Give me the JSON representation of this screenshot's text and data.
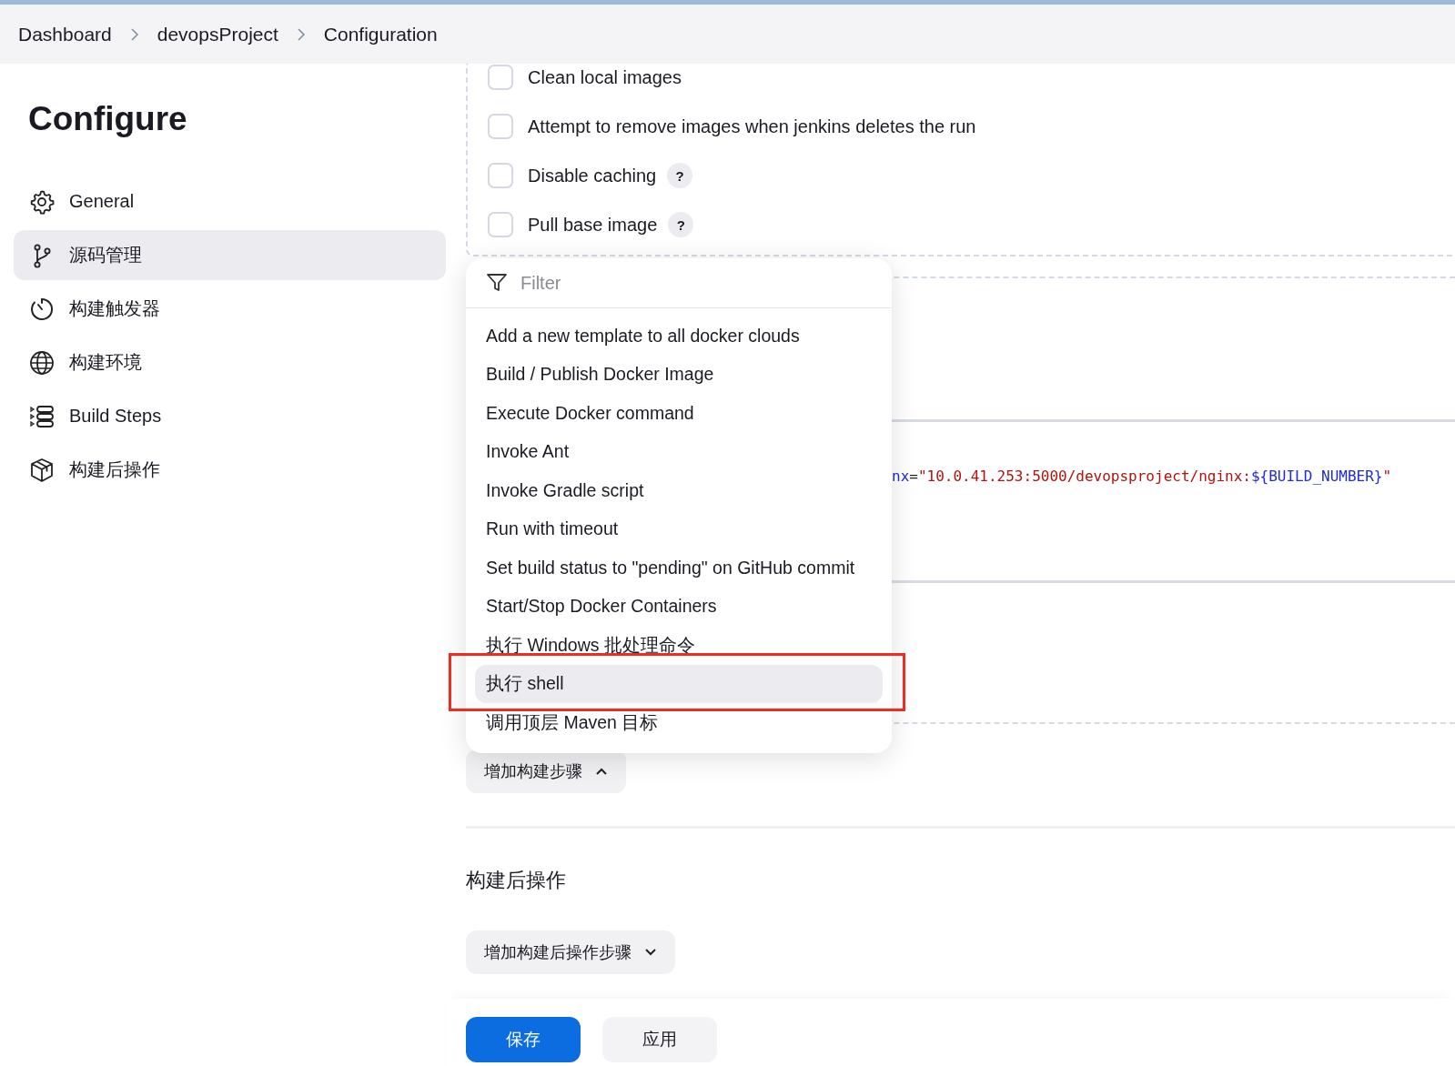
{
  "breadcrumbs": [
    "Dashboard",
    "devopsProject",
    "Configuration"
  ],
  "sidebar": {
    "title": "Configure",
    "items": [
      {
        "kind": "gear",
        "label": "General",
        "selected": false
      },
      {
        "kind": "branch",
        "label": "源码管理",
        "selected": true
      },
      {
        "kind": "timer",
        "label": "构建触发器",
        "selected": false
      },
      {
        "kind": "globe",
        "label": "构建环境",
        "selected": false
      },
      {
        "kind": "steps",
        "label": "Build Steps",
        "selected": false
      },
      {
        "kind": "package",
        "label": "构建后操作",
        "selected": false
      }
    ]
  },
  "options": [
    {
      "label": "Clean local images",
      "checked": false
    },
    {
      "label": "Attempt to remove images when jenkins deletes the run",
      "checked": false
    },
    {
      "label": "Disable caching",
      "checked": false,
      "help": "?"
    },
    {
      "label": "Pull base image",
      "checked": false,
      "help": "?"
    }
  ],
  "code_line": [
    {
      "kind": "name",
      "text": "nx"
    },
    {
      "kind": "op",
      "text": "="
    },
    {
      "kind": "string",
      "text": "\"10.0.41.253:5000/devopsproject/nginx:"
    },
    {
      "kind": "var",
      "text": "${BUILD_NUMBER}"
    },
    {
      "kind": "string",
      "text": "\""
    }
  ],
  "step_menu": {
    "filter_placeholder": "Filter",
    "items": [
      {
        "label": "Add a new template to all docker clouds",
        "selected": false,
        "annotated": false
      },
      {
        "label": "Build / Publish Docker Image",
        "selected": false,
        "annotated": false
      },
      {
        "label": "Execute Docker command",
        "selected": false,
        "annotated": false
      },
      {
        "label": "Invoke Ant",
        "selected": false,
        "annotated": false
      },
      {
        "label": "Invoke Gradle script",
        "selected": false,
        "annotated": false
      },
      {
        "label": "Run with timeout",
        "selected": false,
        "annotated": false
      },
      {
        "label": "Set build status to \"pending\" on GitHub commit",
        "selected": false,
        "annotated": false
      },
      {
        "label": "Start/Stop Docker Containers",
        "selected": false,
        "annotated": false
      },
      {
        "label": "执行 Windows 批处理命令",
        "selected": false,
        "annotated": false
      },
      {
        "label": "执行 shell",
        "selected": true,
        "annotated": true
      },
      {
        "label": "调用顶层 Maven 目标",
        "selected": false,
        "annotated": false
      }
    ]
  },
  "add_step_button": {
    "label": "增加构建步骤",
    "expanded": true
  },
  "post_build": {
    "heading": "构建后操作",
    "button": {
      "label": "增加构建后操作步骤",
      "expanded": false
    }
  },
  "footer": {
    "buttons": [
      {
        "label": "保存",
        "kind": "primary"
      },
      {
        "label": "应用",
        "kind": "secondary"
      }
    ]
  }
}
